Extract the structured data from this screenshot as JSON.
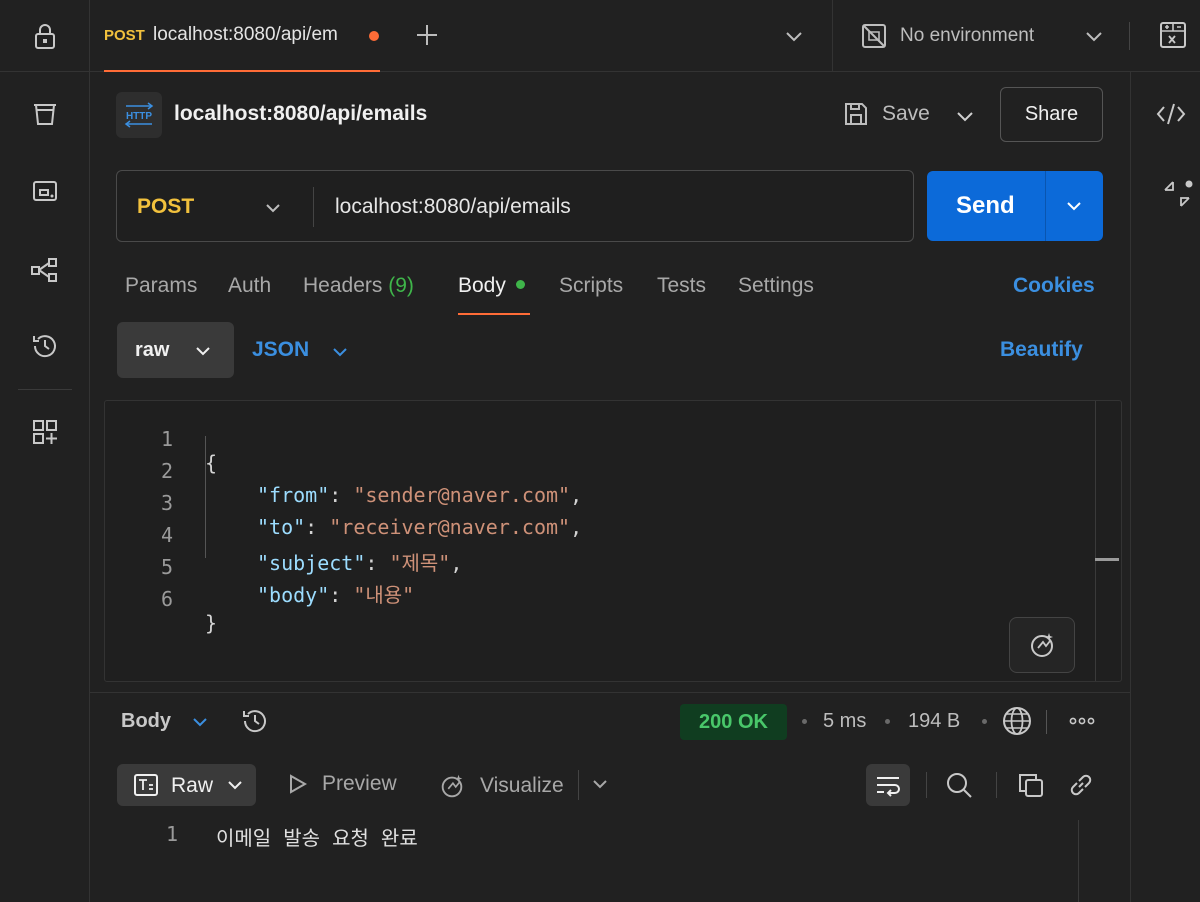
{
  "tabbar": {
    "tab_method": "POST",
    "tab_title": "localhost:8080/api/em",
    "environment": "No environment"
  },
  "request": {
    "name": "localhost:8080/api/emails",
    "save_label": "Save",
    "share_label": "Share",
    "method": "POST",
    "url": "localhost:8080/api/emails",
    "send_label": "Send"
  },
  "request_tabs": {
    "params": "Params",
    "auth": "Auth",
    "headers": "Headers",
    "headers_count": "(9)",
    "body": "Body",
    "scripts": "Scripts",
    "tests": "Tests",
    "settings": "Settings",
    "cookies": "Cookies"
  },
  "body_mode": {
    "raw": "raw",
    "format": "JSON",
    "beautify": "Beautify"
  },
  "editor": {
    "lines": [
      {
        "n": "1",
        "open": "{"
      },
      {
        "n": "2",
        "key": "\"from\"",
        "colon": ": ",
        "val": "\"sender@naver.com\"",
        "comma": ","
      },
      {
        "n": "3",
        "key": "\"to\"",
        "colon": ": ",
        "val": "\"receiver@naver.com\"",
        "comma": ","
      },
      {
        "n": "4",
        "key": "\"subject\"",
        "colon": ": ",
        "val": "\"제목\"",
        "comma": ","
      },
      {
        "n": "5",
        "key": "\"body\"",
        "colon": ": ",
        "val": "\"내용\"",
        "comma": ""
      },
      {
        "n": "6",
        "close": "}"
      }
    ]
  },
  "response": {
    "body_label": "Body",
    "status": "200 OK",
    "time": "5 ms",
    "size": "194 B",
    "view_raw": "Raw",
    "view_preview": "Preview",
    "view_visualize": "Visualize",
    "line_number": "1",
    "line_text": "이메일 발송 요청 완료"
  },
  "colors": {
    "accent_orange": "#ff6c37",
    "method_yellow": "#f2c13d",
    "send_blue": "#0c6ad9",
    "link_blue": "#3b8fe0",
    "status_green": "#49c76a"
  },
  "icons": [
    "lock-icon",
    "trash-icon",
    "monitor-icon",
    "flows-icon",
    "history-icon",
    "add-widget-icon",
    "no-environment-icon",
    "calculator-icon",
    "code-icon",
    "expand-icon",
    "http-icon",
    "save-icon",
    "globe-icon",
    "magic-icon"
  ]
}
